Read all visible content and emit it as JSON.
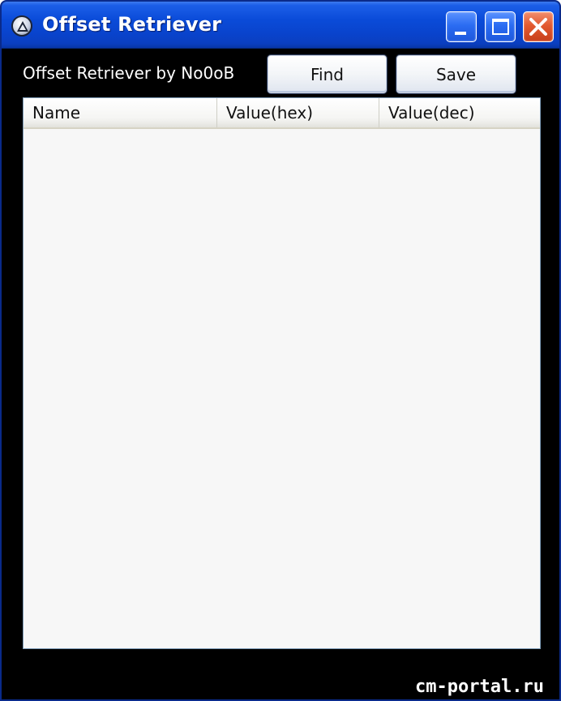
{
  "window": {
    "title": "Offset Retriever",
    "colors": {
      "titlebar": "#0a4bd8",
      "close_button": "#e35a30",
      "client_background": "#000000"
    }
  },
  "toolbar": {
    "caption": "Offset Retriever by No0oB",
    "find_label": "Find",
    "save_label": "Save"
  },
  "listview": {
    "columns": [
      "Name",
      "Value(hex)",
      "Value(dec)"
    ],
    "rows": []
  },
  "watermark": "cm-portal.ru",
  "icons": {
    "app": "app-logo-icon",
    "minimize": "minimize-icon",
    "maximize": "maximize-icon",
    "close": "close-icon"
  }
}
